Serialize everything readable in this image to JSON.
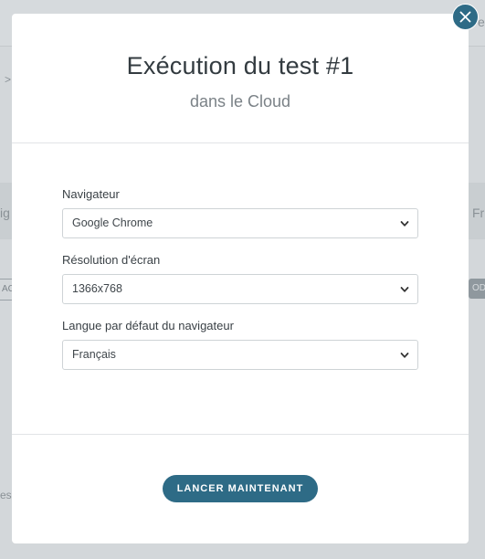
{
  "modal": {
    "title": "Exécution du test #1",
    "subtitle": "dans le Cloud",
    "fields": [
      {
        "label": "Navigateur",
        "value": "Google Chrome"
      },
      {
        "label": "Résolution d'écran",
        "value": "1366x768"
      },
      {
        "label": "Langue par défaut du navigateur",
        "value": "Français"
      }
    ],
    "submit_label": "LANCER MAINTENANT"
  },
  "background": {
    "left_fragments": [
      ">",
      "ig",
      "AC",
      "es"
    ],
    "right_fragments": [
      "Fr",
      "OD",
      "e"
    ]
  },
  "colors": {
    "accent": "#2e6b86",
    "overlay": "#d3d7da"
  },
  "icons": {
    "close": "close-icon",
    "select_arrow": "chevron-down-icon"
  }
}
